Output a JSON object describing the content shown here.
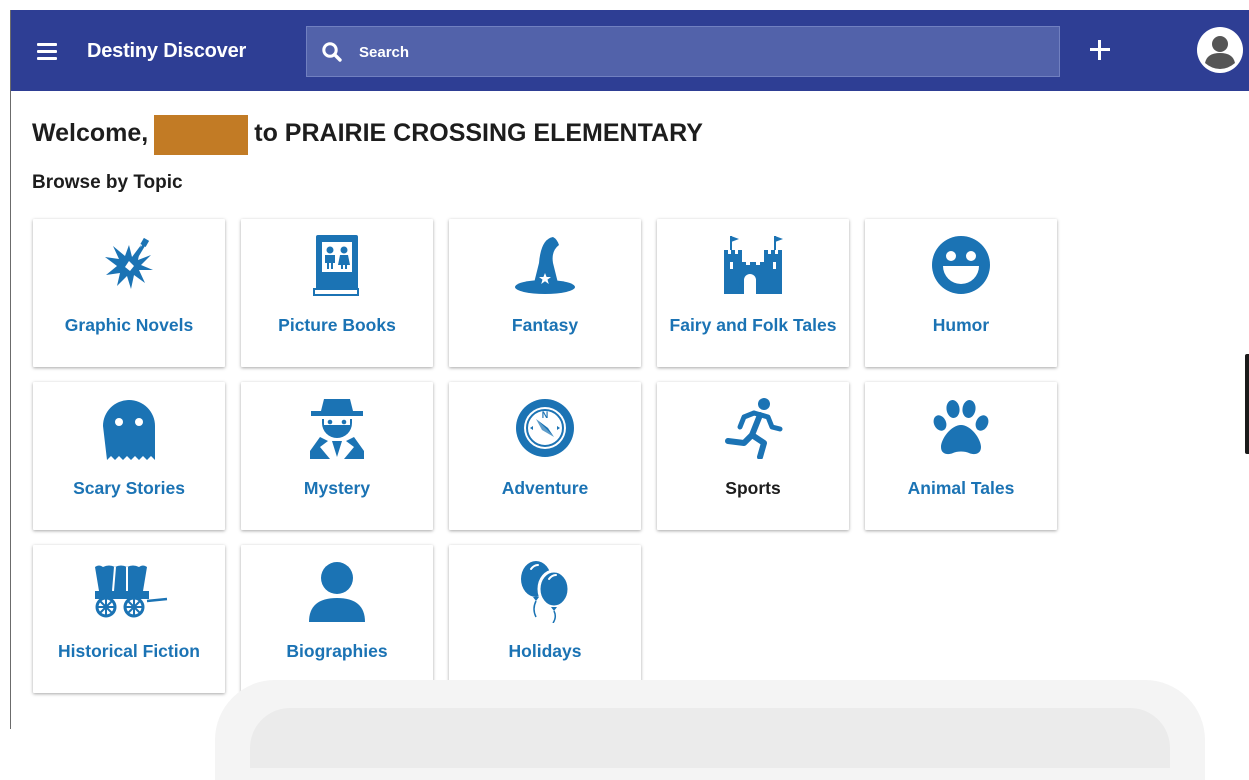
{
  "header": {
    "menu_icon": "hamburger-menu-icon",
    "title": "Destiny Discover",
    "search": {
      "placeholder": "Search",
      "value": "",
      "icon": "search-icon"
    },
    "add_icon": "plus-icon",
    "avatar_icon": "user-avatar-icon"
  },
  "welcome": {
    "prefix": "Welcome,",
    "suffix": "to PRAIRIE CROSSING ELEMENTARY"
  },
  "browse": {
    "title": "Browse by Topic",
    "topics": [
      {
        "label": "Graphic Novels",
        "icon": "graphic-novels-icon"
      },
      {
        "label": "Picture Books",
        "icon": "picture-book-icon"
      },
      {
        "label": "Fantasy",
        "icon": "wizard-hat-icon"
      },
      {
        "label": "Fairy and Folk Tales",
        "icon": "castle-icon"
      },
      {
        "label": "Humor",
        "icon": "smiley-face-icon"
      },
      {
        "label": "Scary Stories",
        "icon": "ghost-icon"
      },
      {
        "label": "Mystery",
        "icon": "detective-icon"
      },
      {
        "label": "Adventure",
        "icon": "compass-icon"
      },
      {
        "label": "Sports",
        "icon": "runner-icon"
      },
      {
        "label": "Animal Tales",
        "icon": "paw-print-icon"
      },
      {
        "label": "Historical Fiction",
        "icon": "covered-wagon-icon"
      },
      {
        "label": "Biographies",
        "icon": "person-icon"
      },
      {
        "label": "Holidays",
        "icon": "balloons-icon"
      }
    ]
  },
  "colors": {
    "header_bg": "#2e3e94",
    "search_bg": "#5262aa",
    "accent": "#1b73b4",
    "redaction": "#c27b25"
  }
}
